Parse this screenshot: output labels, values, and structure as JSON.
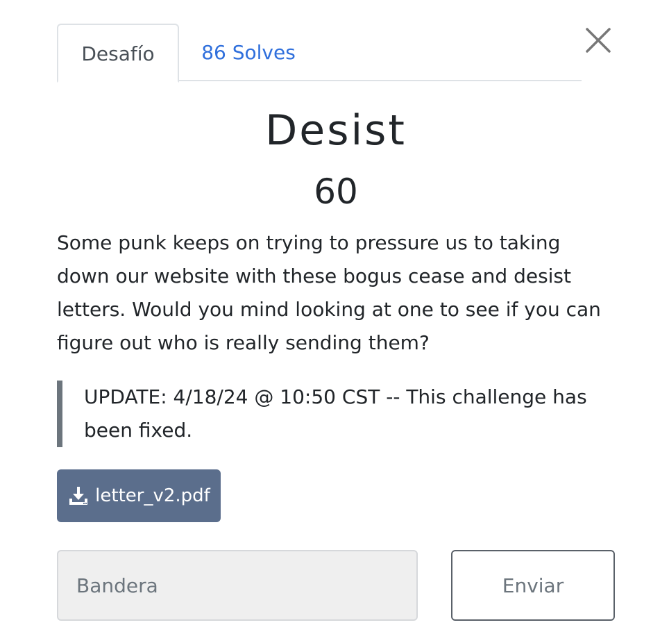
{
  "tabs": [
    {
      "label": "Desafío",
      "active": true
    },
    {
      "label": "86 Solves",
      "active": false
    }
  ],
  "close_icon": "close-icon",
  "challenge": {
    "name": "Desist",
    "points": "60",
    "description": "Some punk keeps on trying to pressure us to taking down our website with these bogus cease and desist letters. Would you mind looking at one to see if you can figure out who is really sending them?",
    "update_note": "UPDATE: 4/18/24 @ 10:50 CST -- This challenge has been fixed."
  },
  "files": [
    {
      "name": "letter_v2.pdf",
      "icon": "download-icon"
    }
  ],
  "submission": {
    "placeholder": "Bandera",
    "value": "",
    "submit_label": "Enviar"
  },
  "colors": {
    "link": "#2f6fdc",
    "file_button": "#5b6e8c",
    "quote_border": "#6c757d"
  }
}
